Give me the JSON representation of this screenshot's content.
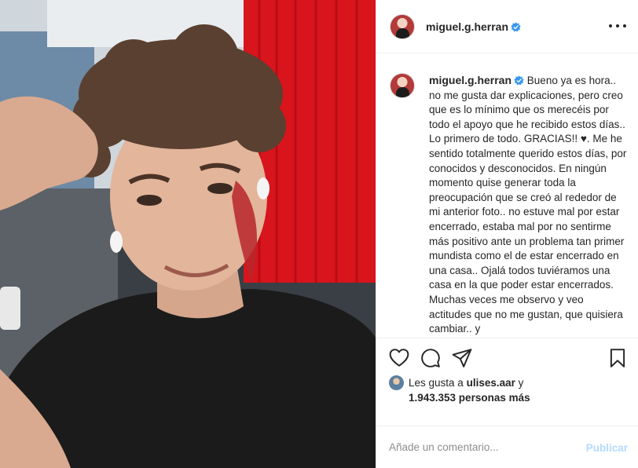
{
  "post": {
    "username": "miguel.g.herran",
    "verified": true,
    "caption": "Bueno ya es hora.. no me gusta dar explicaciones, pero creo que es lo mínimo que os merecéis por todo el apoyo que he recibido estos días.. Lo primero de todo. GRACIAS!! ♥. Me he sentido totalmente querido estos días, por conocidos y desconocidos. En ningún momento quise generar toda la preocupación que se creó al rededor de mi anterior foto.. no estuve mal por estar encerrado, estaba mal por no sentirme más positivo ante un problema tan primer mundista como el de estar encerrado en una casa.. Ojalá todos tuviéramos una casa en la que poder estar encerrados. Muchas veces me observo y veo actitudes que no me gustan, que quisiera cambiar.. y"
  },
  "likes": {
    "prefix": "Les gusta a",
    "liker": "ulises.aar",
    "conj": "y",
    "others": "1.943.353 personas más"
  },
  "comment": {
    "placeholder": "Añade un comentario...",
    "publish_label": "Publicar"
  },
  "icons": {
    "like": "heart-icon",
    "comment": "comment-icon",
    "share": "paper-plane-icon",
    "save": "bookmark-icon",
    "verified": "verified-badge-icon",
    "more": "more-options-icon"
  },
  "colors": {
    "verified": "#3897f0",
    "publish_disabled": "#b3dbff",
    "border": "#efefef",
    "curtain": "#d8141c"
  }
}
